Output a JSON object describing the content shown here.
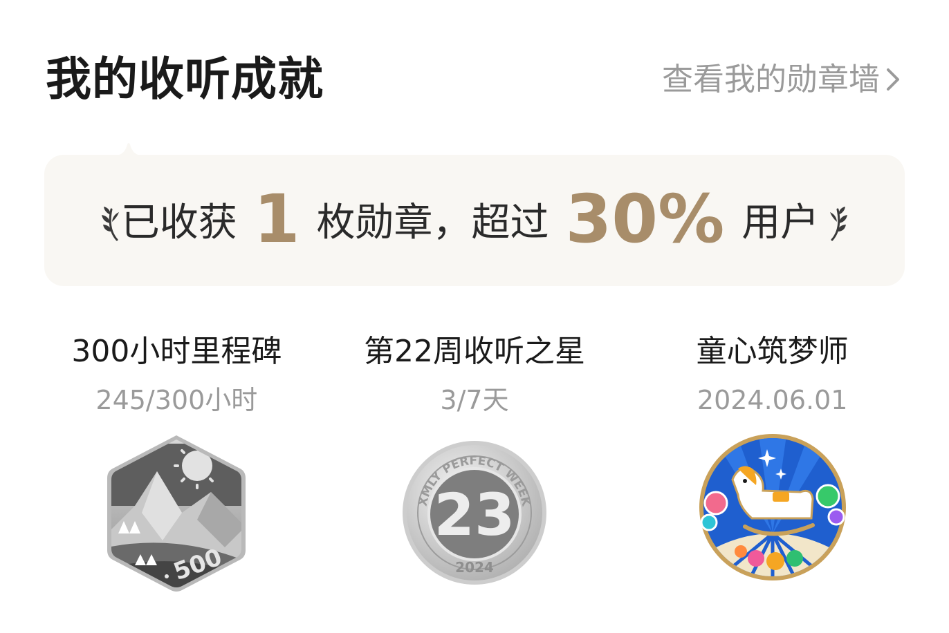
{
  "header": {
    "title": "我的收听成就",
    "wall_link": "查看我的勋章墙",
    "wall_link_icon": "chevron-right-icon"
  },
  "summary": {
    "prefix": "已收获",
    "badge_count": "1",
    "middle": "枚勋章，超过",
    "percent": "30%",
    "suffix": "用户",
    "accent_color": "#a88d6a"
  },
  "badges": [
    {
      "name": "300小时里程碑",
      "progress": "245/300小时",
      "icon": "mountain-milestone-icon",
      "emblem_text": "500"
    },
    {
      "name": "第22周收听之星",
      "progress": "3/7天",
      "icon": "perfect-week-coin-icon",
      "emblem_text": "23",
      "emblem_arc": "XMLY PERFECT WEEK",
      "emblem_year": "2024"
    },
    {
      "name": "童心筑梦师",
      "progress": "2024.06.01",
      "icon": "rocking-horse-icon"
    }
  ]
}
